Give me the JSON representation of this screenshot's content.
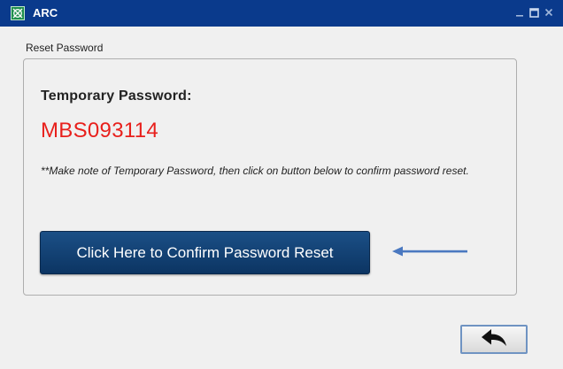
{
  "window": {
    "title": "ARC",
    "app_icon": "arc-logo-icon",
    "controls": [
      "minimize-icon",
      "maximize-icon",
      "close-icon"
    ]
  },
  "section_label": "Reset Password",
  "panel": {
    "temp_password_label": "Temporary Password:",
    "temp_password_value": "MBS093114",
    "note_text": "**Make note of Temporary Password, then click on button below to confirm password reset.",
    "confirm_button_label": "Click Here to Confirm Password Reset"
  },
  "annotation": {
    "arrow_icon": "arrow-left-icon"
  },
  "back_button": {
    "icon": "back-arrow-icon"
  },
  "colors": {
    "titlebar": "#0a3a8c",
    "password": "#e8201c",
    "confirm_button": "#0c3563",
    "annotation_arrow": "#4a78c0"
  }
}
